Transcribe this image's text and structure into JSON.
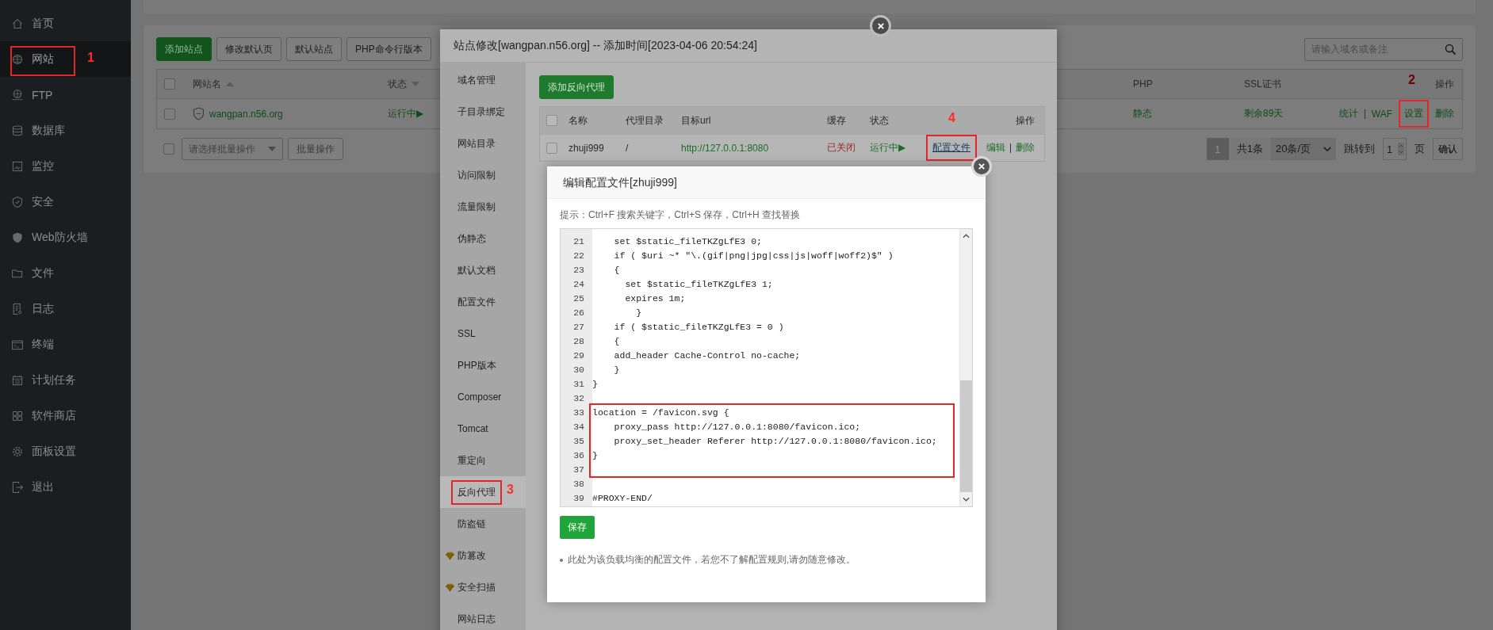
{
  "sidebar": {
    "items": [
      {
        "label": "首页",
        "selected": false
      },
      {
        "label": "网站",
        "selected": true,
        "annotation": "1"
      },
      {
        "label": "FTP",
        "selected": false
      },
      {
        "label": "数据库",
        "selected": false
      },
      {
        "label": "监控",
        "selected": false
      },
      {
        "label": "安全",
        "selected": false
      },
      {
        "label": "Web防火墙",
        "selected": false
      },
      {
        "label": "文件",
        "selected": false
      },
      {
        "label": "日志",
        "selected": false
      },
      {
        "label": "终端",
        "selected": false
      },
      {
        "label": "计划任务",
        "selected": false
      },
      {
        "label": "软件商店",
        "selected": false
      },
      {
        "label": "面板设置",
        "selected": false
      },
      {
        "label": "退出",
        "selected": false
      }
    ]
  },
  "site_list": {
    "toolbar_buttons": [
      {
        "label": "添加站点",
        "kind": "primary"
      },
      {
        "label": "修改默认页",
        "kind": "default"
      },
      {
        "label": "默认站点",
        "kind": "default"
      },
      {
        "label": "PHP命令行版本",
        "kind": "default"
      }
    ],
    "search": {
      "placeholder": "请输入域名或备注"
    },
    "header_checked": false,
    "columns": [
      "网站名",
      "状态",
      "PHP",
      "SSL证书",
      "操作"
    ],
    "rows": [
      {
        "checked": false,
        "name": "wangpan.n56.org",
        "status": "运行中▶",
        "php": "静态",
        "ssl": "剩余89天",
        "actions": [
          {
            "label": "统计"
          },
          {
            "label": "WAF"
          },
          {
            "label": "设置",
            "annotation": "2"
          },
          {
            "label": "删除"
          }
        ]
      }
    ],
    "batch": {
      "checked": false,
      "placeholder": "请选择批量操作",
      "button": "批量操作"
    },
    "pagination": {
      "current": "1",
      "total": "共1条",
      "per_page": "20条/页",
      "jump_label": "跳转到",
      "jump_value": "1",
      "page_unit": "页",
      "confirm": "确认"
    }
  },
  "site_dialog": {
    "title": "站点修改[wangpan.n56.org] -- 添加时间[2023-04-06 20:54:24]",
    "menu": [
      {
        "label": "域名管理",
        "selected": false,
        "pro": false
      },
      {
        "label": "子目录绑定",
        "selected": false,
        "pro": false
      },
      {
        "label": "网站目录",
        "selected": false,
        "pro": false
      },
      {
        "label": "访问限制",
        "selected": false,
        "pro": false
      },
      {
        "label": "流量限制",
        "selected": false,
        "pro": false
      },
      {
        "label": "伪静态",
        "selected": false,
        "pro": false
      },
      {
        "label": "默认文档",
        "selected": false,
        "pro": false
      },
      {
        "label": "配置文件",
        "selected": false,
        "pro": false
      },
      {
        "label": "SSL",
        "selected": false,
        "pro": false
      },
      {
        "label": "PHP版本",
        "selected": false,
        "pro": false
      },
      {
        "label": "Composer",
        "selected": false,
        "pro": false
      },
      {
        "label": "Tomcat",
        "selected": false,
        "pro": false
      },
      {
        "label": "重定向",
        "selected": false,
        "pro": false
      },
      {
        "label": "反向代理",
        "selected": true,
        "pro": false,
        "annotation": "3"
      },
      {
        "label": "防盗链",
        "selected": false,
        "pro": false
      },
      {
        "label": "防篡改",
        "selected": false,
        "pro": true
      },
      {
        "label": "安全扫描",
        "selected": false,
        "pro": true
      },
      {
        "label": "网站日志",
        "selected": false,
        "pro": false
      }
    ],
    "add_button": "添加反向代理",
    "header_checked": false,
    "columns": [
      "名称",
      "代理目录",
      "目标url",
      "缓存",
      "状态",
      "操作"
    ],
    "rows": [
      {
        "checked": false,
        "name": "zhuji999",
        "dir": "/",
        "url": "http://127.0.0.1:8080",
        "cache": "已关闭",
        "status": "运行中▶",
        "actions": [
          {
            "label": "配置文件",
            "kind": "link",
            "annotation": "4"
          },
          {
            "label": "编辑",
            "kind": "action"
          },
          {
            "label": "删除",
            "kind": "action"
          }
        ]
      }
    ]
  },
  "config_dialog": {
    "title": "编辑配置文件[zhuji999]",
    "hint": "提示：Ctrl+F 搜索关键字，Ctrl+S 保存，Ctrl+H 查找替换",
    "lines": [
      {
        "number": "21",
        "boxed": false,
        "text": "    set $static_fileTKZgLfE3 0;"
      },
      {
        "number": "22",
        "boxed": false,
        "text": "    if ( $uri ~* \"\\.(gif|png|jpg|css|js|woff|woff2)$\" )"
      },
      {
        "number": "23",
        "boxed": false,
        "text": "    {"
      },
      {
        "number": "24",
        "boxed": false,
        "text": "      set $static_fileTKZgLfE3 1;"
      },
      {
        "number": "25",
        "boxed": false,
        "text": "      expires 1m;"
      },
      {
        "number": "26",
        "boxed": false,
        "text": "        }"
      },
      {
        "number": "27",
        "boxed": false,
        "text": "    if ( $static_fileTKZgLfE3 = 0 )"
      },
      {
        "number": "28",
        "boxed": false,
        "text": "    {"
      },
      {
        "number": "29",
        "boxed": false,
        "text": "    add_header Cache-Control no-cache;"
      },
      {
        "number": "30",
        "boxed": false,
        "text": "    }"
      },
      {
        "number": "31",
        "boxed": false,
        "text": "}"
      },
      {
        "number": "32",
        "boxed": false
      },
      {
        "number": "33",
        "boxed": true,
        "text": "location = /favicon.svg {"
      },
      {
        "number": "34",
        "boxed": true,
        "text": "    proxy_pass http://127.0.0.1:8080/favicon.ico;"
      },
      {
        "number": "35",
        "boxed": true,
        "text": "    proxy_set_header Referer http://127.0.0.1:8080/favicon.ico;"
      },
      {
        "number": "36",
        "boxed": true,
        "text": "}"
      },
      {
        "number": "37",
        "boxed": true
      },
      {
        "number": "38",
        "boxed": false
      },
      {
        "number": "39",
        "boxed": false,
        "text": "#PROXY-END/"
      }
    ],
    "save": "保存",
    "note": "此处为该负载均衡的配置文件，若您不了解配置规则,请勿随意修改。"
  }
}
